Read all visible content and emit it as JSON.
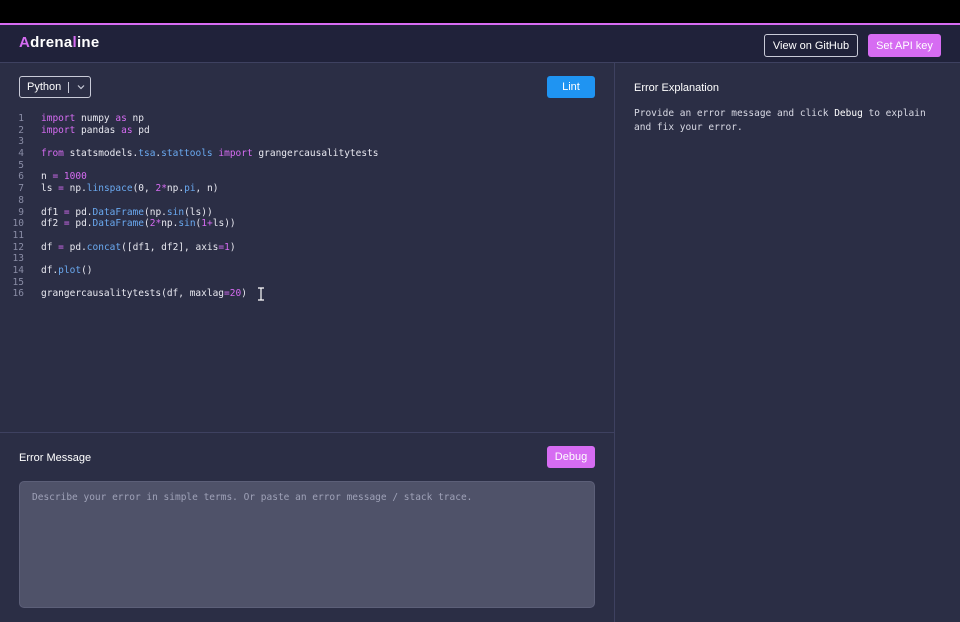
{
  "header": {
    "logo_first": "A",
    "logo_mid": "drena",
    "logo_accent": "l",
    "logo_rest": "ine",
    "github_label": "View on GitHub",
    "api_key_label": "Set API key"
  },
  "editor": {
    "language": "Python",
    "lint_label": "Lint",
    "lines": [
      {
        "n": "1"
      },
      {
        "n": "2"
      },
      {
        "n": "3"
      },
      {
        "n": "4"
      },
      {
        "n": "5"
      },
      {
        "n": "6"
      },
      {
        "n": "7"
      },
      {
        "n": "8"
      },
      {
        "n": "9"
      },
      {
        "n": "10"
      },
      {
        "n": "11"
      },
      {
        "n": "12"
      },
      {
        "n": "13"
      },
      {
        "n": "14"
      },
      {
        "n": "15"
      },
      {
        "n": "16"
      }
    ],
    "code": {
      "l1": [
        "import",
        " numpy ",
        "as",
        " np"
      ],
      "l2": [
        "import",
        " pandas ",
        "as",
        " pd"
      ],
      "l4": [
        "from",
        " statsmodels.",
        "tsa",
        ".",
        "stattools",
        " ",
        "import",
        " grangercausalitytests"
      ],
      "l6": [
        "n ",
        "=",
        " ",
        "1000"
      ],
      "l7": [
        "ls ",
        "=",
        " np.",
        "linspace",
        "(0, ",
        "2",
        "*",
        "np.",
        "pi",
        ", n)"
      ],
      "l9": [
        "df1 ",
        "=",
        " pd.",
        "DataFrame",
        "(np.",
        "sin",
        "(ls))"
      ],
      "l10": [
        "df2 ",
        "=",
        " pd.",
        "DataFrame",
        "(",
        "2",
        "*",
        "np.",
        "sin",
        "(",
        "1",
        "+",
        "ls))"
      ],
      "l12": [
        "df ",
        "=",
        " pd.",
        "concat",
        "([df1, df2], axis",
        "=",
        "1",
        ")"
      ],
      "l14": [
        "df.",
        "plot",
        "()"
      ],
      "l16": [
        "grangercausalitytests(df, maxlag",
        "=",
        "20",
        ")"
      ]
    }
  },
  "error_message": {
    "title": "Error Message",
    "debug_label": "Debug",
    "placeholder": "Describe your error in simple terms. Or paste an error message / stack trace."
  },
  "explanation": {
    "title": "Error Explanation",
    "text_before": "Provide an error message and click ",
    "text_bold": "Debug",
    "text_after": " to explain and fix your error."
  },
  "colors": {
    "accent": "#d66cf2",
    "lint_blue": "#1f94f2",
    "background": "#2b2e45"
  }
}
